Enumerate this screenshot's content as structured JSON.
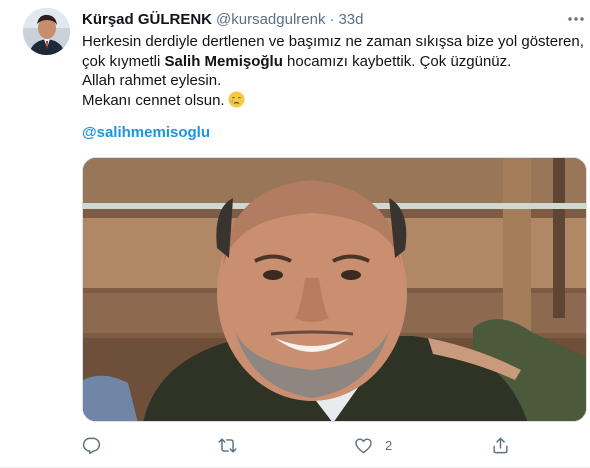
{
  "tweet": {
    "author_name": "Kürşad GÜLRENK",
    "author_handle": "@kursadgulrenk",
    "separator": "·",
    "time": "33d",
    "lines": [
      "Herkesin derdiyle dertlenen ve başımız ne zaman sıkışsa bize yol gösteren,",
      "Allah rahmet eylesin.",
      "Mekanı cennet olsun."
    ],
    "line2_pre": "çok kıymetli ",
    "line2_bold": "Salih Memişoğlu",
    "line2_post": " hocamızı kaybettik. Çok üzgünüz.",
    "mention": "@salihmemisoglu",
    "emoji_icon": "crying-face-icon"
  },
  "actions": {
    "reply_count": "",
    "retweet_count": "",
    "like_count": "2",
    "icons": [
      "reply-icon",
      "retweet-icon",
      "like-icon",
      "share-icon"
    ]
  },
  "colors": {
    "text": "#0f1419",
    "secondary": "#5b7083",
    "link": "#1b95e0",
    "border": "#ebeef0"
  }
}
